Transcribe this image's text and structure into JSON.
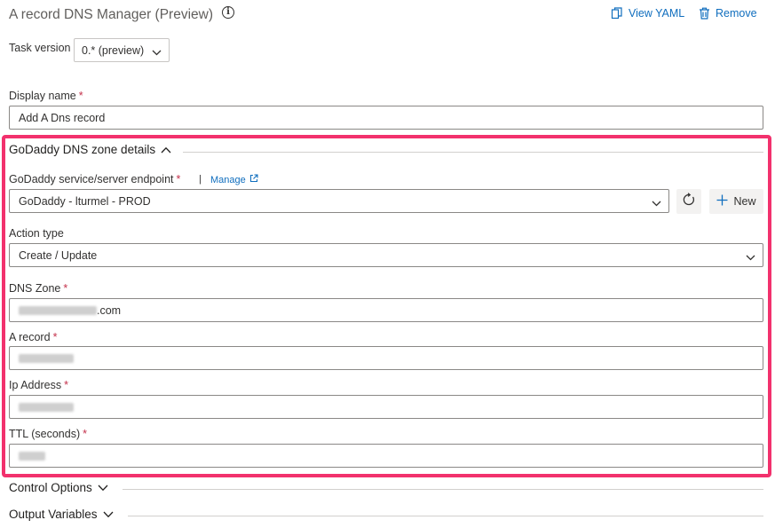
{
  "header": {
    "title": "A record DNS Manager (Preview)",
    "view_yaml": "View YAML",
    "remove": "Remove"
  },
  "task_version": {
    "label": "Task version",
    "value": "0.* (preview)"
  },
  "display_name": {
    "label": "Display name",
    "value": "Add A Dns record"
  },
  "godaddy_section": {
    "title": "GoDaddy DNS zone details",
    "endpoint": {
      "label": "GoDaddy service/server endpoint",
      "manage": "Manage",
      "value": "GoDaddy - lturmel - PROD",
      "new_label": "New"
    },
    "action_type": {
      "label": "Action type",
      "value": "Create / Update"
    },
    "dns_zone": {
      "label": "DNS Zone",
      "value_suffix": ".com"
    },
    "a_record": {
      "label": "A record"
    },
    "ip_address": {
      "label": "Ip Address"
    },
    "ttl": {
      "label": "TTL (seconds)"
    }
  },
  "control_options": {
    "title": "Control Options"
  },
  "output_variables": {
    "title": "Output Variables"
  },
  "colors": {
    "accent": "#106ebe",
    "highlight": "#f2316d",
    "required": "#c4314b"
  },
  "icons": [
    "info-icon",
    "yaml-icon",
    "trash-icon",
    "chevron-down-icon",
    "chevron-up-icon",
    "external-link-icon",
    "refresh-icon",
    "plus-icon"
  ]
}
